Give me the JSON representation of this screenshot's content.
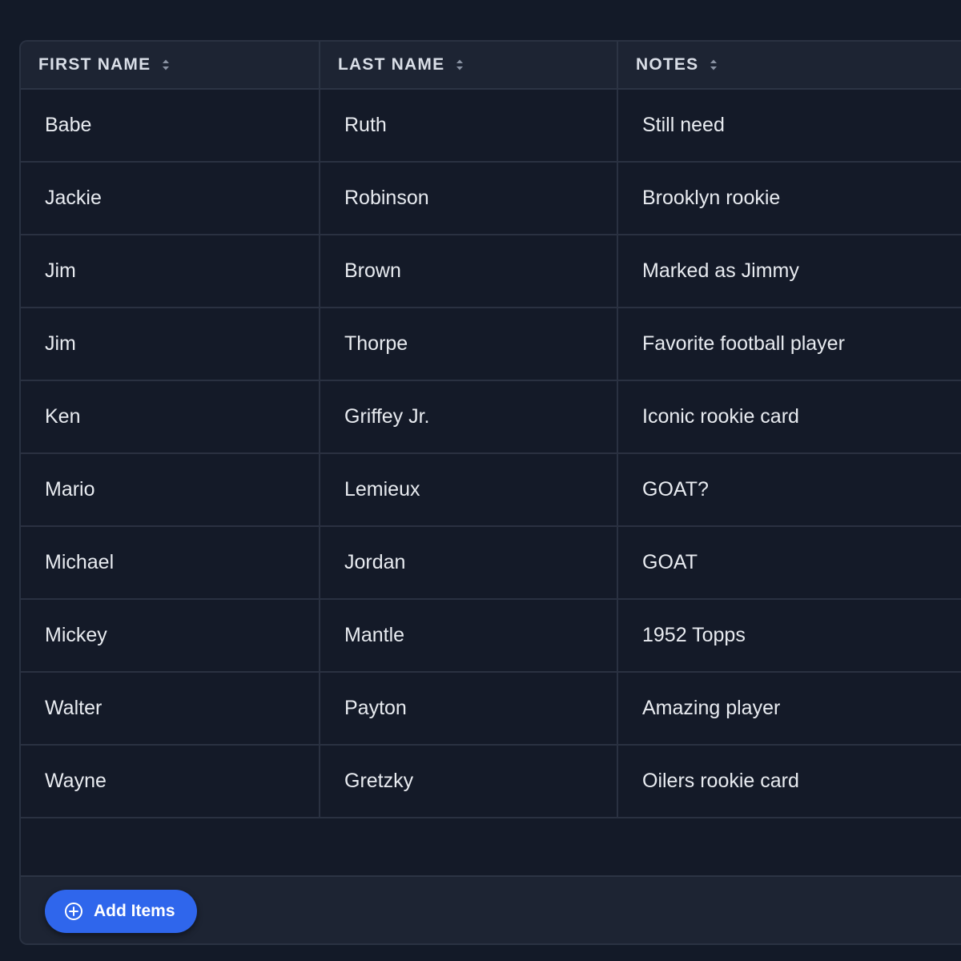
{
  "table": {
    "columns": [
      {
        "label": "FIRST NAME",
        "icon": "sort-icon"
      },
      {
        "label": "LAST NAME",
        "icon": "sort-icon"
      },
      {
        "label": "NOTES",
        "icon": "sort-icon"
      }
    ],
    "rows": [
      {
        "first": "Babe",
        "last": "Ruth",
        "notes": "Still need"
      },
      {
        "first": "Jackie",
        "last": "Robinson",
        "notes": "Brooklyn rookie"
      },
      {
        "first": "Jim",
        "last": "Brown",
        "notes": "Marked as Jimmy"
      },
      {
        "first": "Jim",
        "last": "Thorpe",
        "notes": "Favorite football player"
      },
      {
        "first": "Ken",
        "last": "Griffey Jr.",
        "notes": "Iconic rookie card"
      },
      {
        "first": "Mario",
        "last": "Lemieux",
        "notes": "GOAT?"
      },
      {
        "first": "Michael",
        "last": "Jordan",
        "notes": "GOAT"
      },
      {
        "first": "Mickey",
        "last": "Mantle",
        "notes": "1952 Topps"
      },
      {
        "first": "Walter",
        "last": "Payton",
        "notes": "Amazing player"
      },
      {
        "first": "Wayne",
        "last": "Gretzky",
        "notes": "Oilers rookie card"
      }
    ]
  },
  "footer": {
    "add_button_label": "Add Items",
    "add_button_icon": "plus-circle-icon"
  },
  "colors": {
    "background": "#131a28",
    "header_bg": "#1d2433",
    "accent": "#2f66ec",
    "text": "#e8ebf0"
  }
}
